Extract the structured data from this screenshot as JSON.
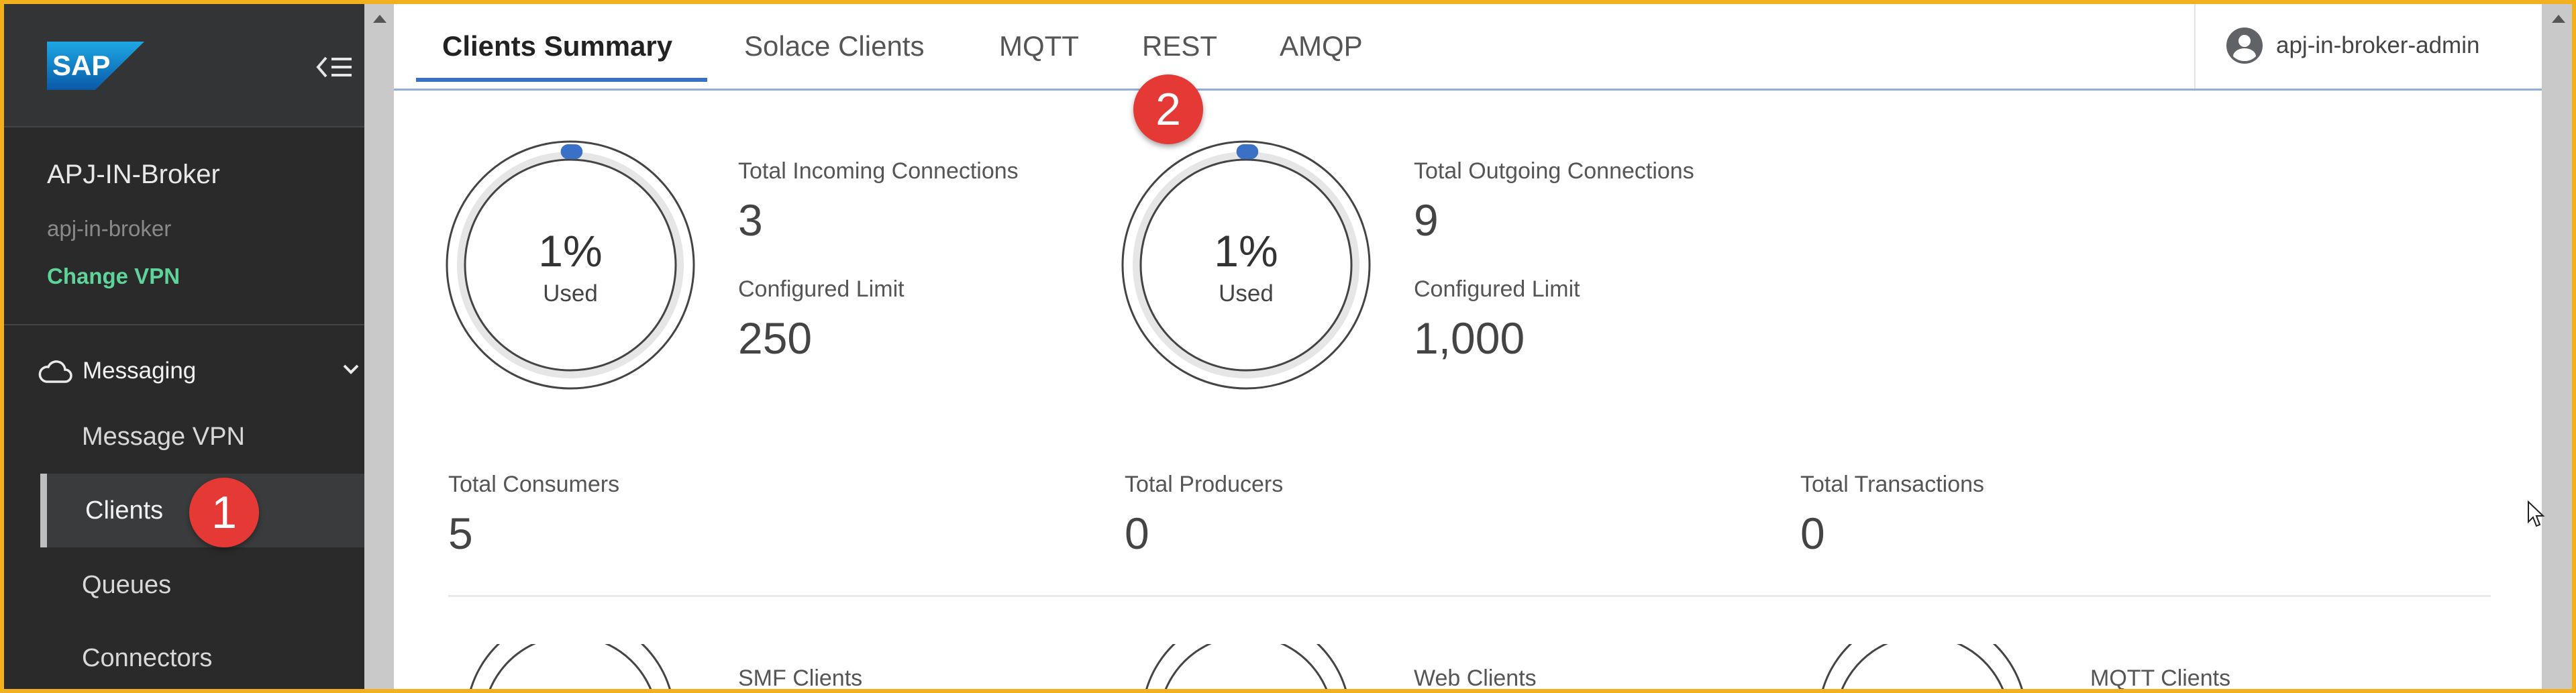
{
  "sidebar": {
    "logo_text": "SAP",
    "broker_name": "APJ-IN-Broker",
    "broker_id": "apj-in-broker",
    "change_vpn": "Change VPN",
    "section": "Messaging",
    "items": [
      {
        "label": "Message VPN"
      },
      {
        "label": "Clients"
      },
      {
        "label": "Queues"
      },
      {
        "label": "Connectors"
      }
    ]
  },
  "tabs": [
    {
      "label": "Clients Summary"
    },
    {
      "label": "Solace Clients"
    },
    {
      "label": "MQTT"
    },
    {
      "label": "REST"
    },
    {
      "label": "AMQP"
    }
  ],
  "user": {
    "name": "apj-in-broker-admin"
  },
  "badges": {
    "one": "1",
    "two": "2"
  },
  "incoming": {
    "percent_text": "1%",
    "used_label": "Used",
    "title": "Total Incoming Connections",
    "value": "3",
    "limit_label": "Configured Limit",
    "limit_value": "250",
    "fraction": 0.01
  },
  "outgoing": {
    "percent_text": "1%",
    "used_label": "Used",
    "title": "Total Outgoing Connections",
    "value": "9",
    "limit_label": "Configured Limit",
    "limit_value": "1,000",
    "fraction": 0.01
  },
  "stats": [
    {
      "label": "Total Consumers",
      "value": "5"
    },
    {
      "label": "Total Producers",
      "value": "0"
    },
    {
      "label": "Total Transactions",
      "value": "0"
    }
  ],
  "bottom_labels": [
    "SMF Clients",
    "Web Clients",
    "MQTT Clients"
  ],
  "colors": {
    "accent": "#3b70c7",
    "badge": "#e53935",
    "change_vpn": "#5ed39a",
    "frame": "#f2b01e"
  }
}
